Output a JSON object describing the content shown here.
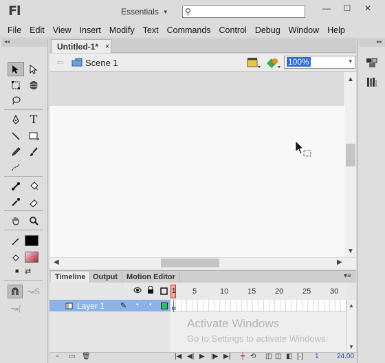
{
  "app": {
    "logo": "Fl",
    "workspace": "Essentials",
    "search_placeholder": ""
  },
  "window_controls": {
    "minimize": "—",
    "maximize": "☐",
    "close": "✕"
  },
  "menu": [
    "File",
    "Edit",
    "View",
    "Insert",
    "Modify",
    "Text",
    "Commands",
    "Control",
    "Debug",
    "Window",
    "Help"
  ],
  "document": {
    "tab_label": "Untitled-1*",
    "tab_close": "×",
    "scene_label": "Scene 1",
    "zoom": "100%"
  },
  "timeline": {
    "tabs": [
      "Timeline",
      "Output",
      "Motion Editor"
    ],
    "frame_numbers": [
      "1",
      "5",
      "10",
      "15",
      "20",
      "25",
      "30"
    ],
    "layer_name": "Layer 1",
    "current_frame": "1",
    "fps": "24.00"
  },
  "watermark": {
    "title": "Activate Windows",
    "subtitle": "Go to Settings to activate Windows."
  },
  "colors": {
    "layer_highlight": "#8db3e6",
    "playhead": "#e14040",
    "outline_swatch": "#2ec452",
    "zoom_selection": "#2b6fd6"
  },
  "icons": [
    "selection-tool-icon",
    "subselection-tool-icon",
    "free-transform-icon",
    "3d-rotation-icon",
    "lasso-icon",
    "pen-icon",
    "text-icon",
    "line-icon",
    "rectangle-icon",
    "pencil-icon",
    "brush-icon",
    "deco-icon",
    "bone-icon",
    "paint-bucket-icon",
    "eyedropper-icon",
    "eraser-icon",
    "hand-icon",
    "zoom-icon",
    "stroke-color-icon",
    "fill-color-icon",
    "snap-magnet-icon",
    "smooth-icon",
    "straighten-icon",
    "color-panel-icon",
    "library-panel-icon"
  ]
}
